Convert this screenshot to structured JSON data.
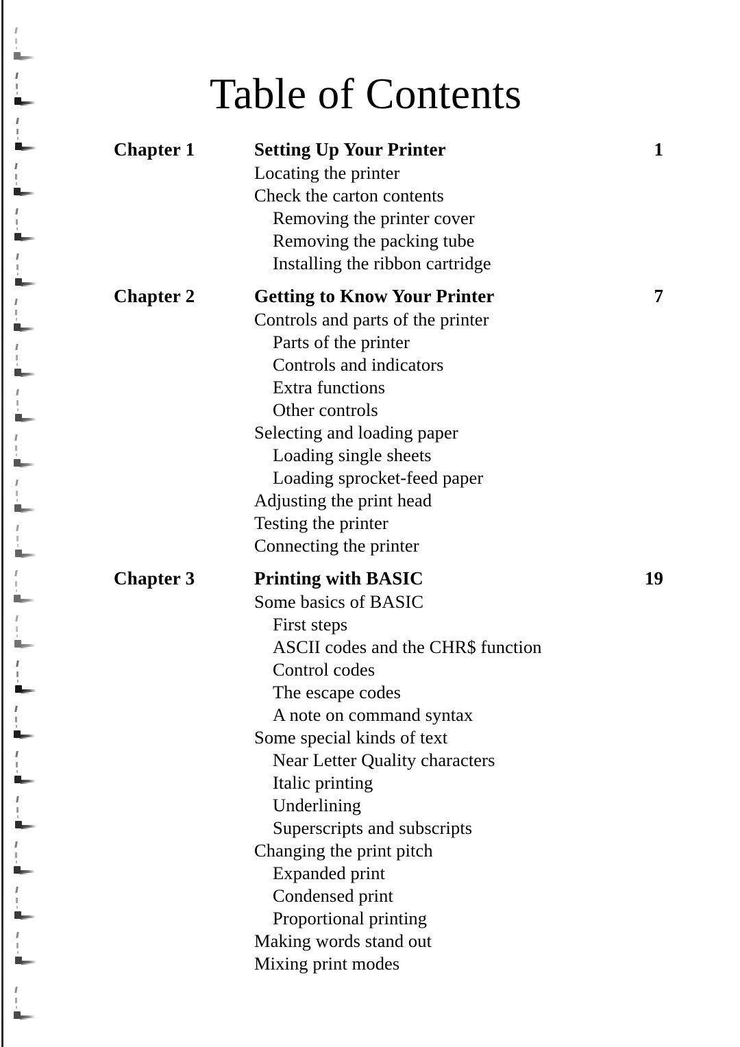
{
  "page": {
    "title": "Table of Contents"
  },
  "chapters": [
    {
      "label": "Chapter 1",
      "title": "Setting Up Your Printer",
      "page": "1",
      "entries": [
        {
          "text": "Locating the printer",
          "level": 1
        },
        {
          "text": "Check the carton contents",
          "level": 1
        },
        {
          "text": "Removing the printer cover",
          "level": 2
        },
        {
          "text": "Removing the packing tube",
          "level": 2
        },
        {
          "text": "Installing the ribbon cartridge",
          "level": 2
        }
      ]
    },
    {
      "label": "Chapter 2",
      "title": "Getting to Know Your Printer",
      "page": "7",
      "entries": [
        {
          "text": "Controls and parts of the printer",
          "level": 1
        },
        {
          "text": "Parts of the printer",
          "level": 2
        },
        {
          "text": "Controls and indicators",
          "level": 2
        },
        {
          "text": "Extra functions",
          "level": 2
        },
        {
          "text": "Other controls",
          "level": 2
        },
        {
          "text": "Selecting and loading paper",
          "level": 1
        },
        {
          "text": "Loading single sheets",
          "level": 2
        },
        {
          "text": "Loading sprocket-feed paper",
          "level": 2
        },
        {
          "text": "Adjusting the print head",
          "level": 1
        },
        {
          "text": "Testing the printer",
          "level": 1
        },
        {
          "text": "Connecting the printer",
          "level": 1
        }
      ]
    },
    {
      "label": "Chapter 3",
      "title": "Printing with BASIC",
      "page": "19",
      "entries": [
        {
          "text": "Some basics of BASIC",
          "level": 1
        },
        {
          "text": "First steps",
          "level": 2
        },
        {
          "text": "ASCII codes and the CHR$ function",
          "level": 2
        },
        {
          "text": "Control codes",
          "level": 2
        },
        {
          "text": "The escape codes",
          "level": 2
        },
        {
          "text": "A note on command syntax",
          "level": 2
        },
        {
          "text": "Some special kinds of text",
          "level": 1
        },
        {
          "text": "Near Letter Quality characters",
          "level": 2
        },
        {
          "text": "Italic printing",
          "level": 2
        },
        {
          "text": "Underlining",
          "level": 2
        },
        {
          "text": "Superscripts and subscripts",
          "level": 2
        },
        {
          "text": "Changing the print pitch",
          "level": 1
        },
        {
          "text": "Expanded print",
          "level": 2
        },
        {
          "text": "Condensed print",
          "level": 2
        },
        {
          "text": "Proportional printing",
          "level": 2
        },
        {
          "text": "Making words stand out",
          "level": 1
        },
        {
          "text": "Mixing print modes",
          "level": 1
        }
      ]
    }
  ],
  "scan_artifacts": {
    "edge_line_color": "#141414",
    "mark_color": "#050505",
    "mark_top_positions": [
      40,
      106,
      172,
      238,
      304,
      370,
      436,
      502,
      568,
      634,
      700,
      766,
      832,
      898,
      964,
      1030,
      1096,
      1162,
      1228,
      1294,
      1360,
      1440
    ]
  }
}
